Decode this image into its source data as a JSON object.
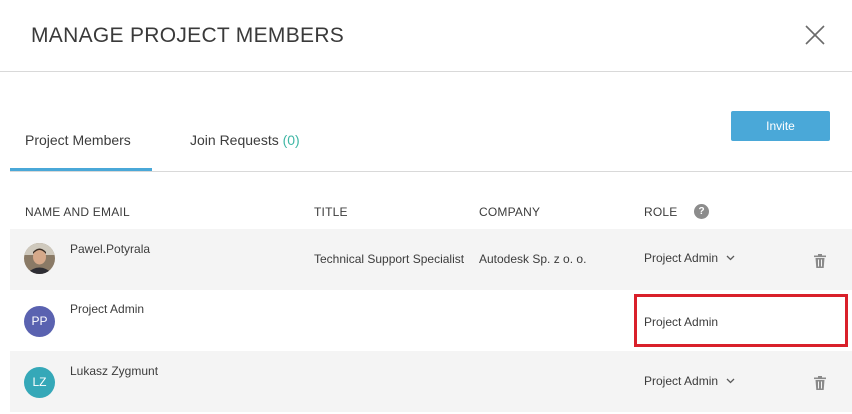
{
  "dialog": {
    "title": "MANAGE PROJECT MEMBERS"
  },
  "tabs": {
    "members_label": "Project Members",
    "requests_label": "Join Requests",
    "requests_count": "(0)"
  },
  "toolbar": {
    "invite_label": "Invite"
  },
  "table": {
    "columns": {
      "name_email": "NAME AND EMAIL",
      "title": "TITLE",
      "company": "COMPANY",
      "role": "ROLE"
    },
    "help_glyph": "?",
    "rows": [
      {
        "name": "Pawel.Potyrala",
        "title": "Technical Support Specialist",
        "company": "Autodesk Sp. z o. o.",
        "role": "Project Admin",
        "avatar_initials": ""
      },
      {
        "name": "Project Admin",
        "title": "",
        "company": "",
        "role": "Project Admin",
        "avatar_initials": "PP"
      },
      {
        "name": "Lukasz Zygmunt",
        "title": "",
        "company": "",
        "role": "Project Admin",
        "avatar_initials": "LZ"
      }
    ]
  },
  "colors": {
    "accent": "#4aa8d8",
    "count": "#3fb7a5",
    "avatar_pp": "#5a62b0",
    "avatar_lz": "#35a8b8",
    "highlight": "#d9202a"
  },
  "icons": {
    "close": "close-icon",
    "help": "help-icon",
    "chevron": "chevron-down-icon",
    "trash": "trash-icon"
  }
}
